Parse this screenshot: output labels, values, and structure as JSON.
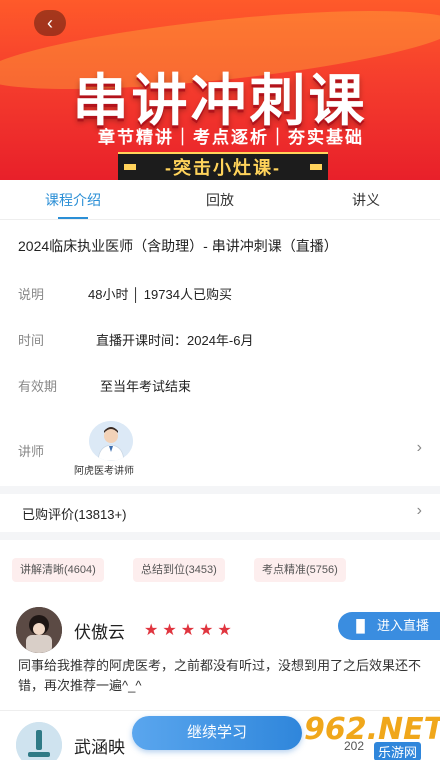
{
  "banner": {
    "back_glyph": "‹",
    "title": "串讲冲刺课",
    "subtitle": "章节精讲｜考点逐析｜夯实基础",
    "tag": "-突击小灶课-"
  },
  "tabs": [
    {
      "label": "课程介绍",
      "active": true
    },
    {
      "label": "回放",
      "active": false
    },
    {
      "label": "讲义",
      "active": false
    }
  ],
  "course": {
    "title": "2024临床执业医师（含助理）- 串讲冲刺课（直播）",
    "desc_label": "说明",
    "desc_value": "48小时 │ 19734人已购买",
    "time_label": "时间",
    "time_value": "直播开课时间：2024年-6月",
    "valid_label": "有效期",
    "valid_value": "至当年考试结束",
    "teacher_label": "讲师",
    "teacher_name": "阿虎医考讲师"
  },
  "rating": {
    "label": "已购评价(13813+)"
  },
  "review_tags": [
    "讲解清晰(4604)",
    "总结到位(3453)",
    "考点精准(5756)"
  ],
  "reviews": [
    {
      "name": "伏傲云",
      "stars": "★★★★★",
      "text": "同事给我推荐的阿虎医考，之前都没有听过，没想到用了之后效果还不错，再次推荐一遍^_^"
    },
    {
      "name": "武涵映",
      "text": ""
    }
  ],
  "buttons": {
    "live": "进入直播",
    "continue": "继续学习"
  },
  "watermark": {
    "brand": "962.NET",
    "site": "乐游网",
    "year_fragment": "202"
  },
  "colors": {
    "accent": "#2b8fd6",
    "banner_red": "#e8202a",
    "star": "#e0353f",
    "tag_bg": "#fdeeee"
  }
}
